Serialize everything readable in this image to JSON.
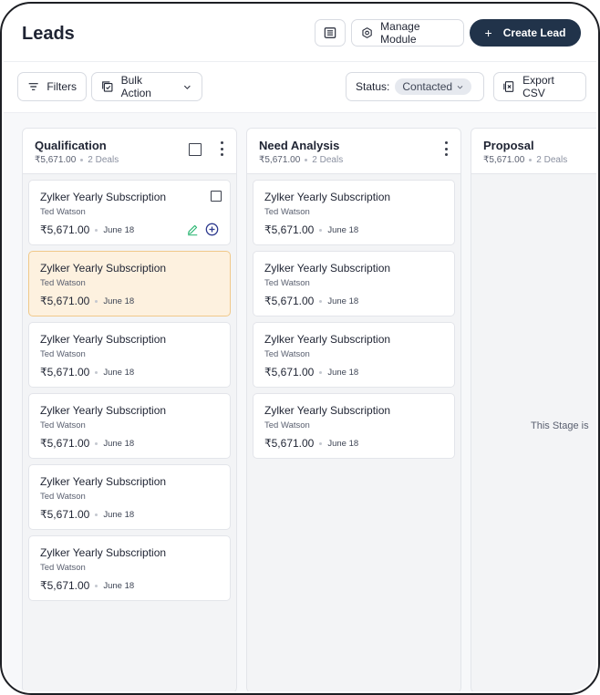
{
  "header": {
    "title": "Leads",
    "manage_label": "Manage Module",
    "create_label": "Create Lead",
    "create_prefix": "+"
  },
  "toolbar": {
    "filters_label": "Filters",
    "bulk_label": "Bulk Action",
    "status_label": "Status:",
    "status_value": "Contacted",
    "export_label": "Export CSV"
  },
  "columns": [
    {
      "title": "Qualification",
      "amount": "₹5,671.00",
      "deals": "2 Deals",
      "cards": [
        {
          "title": "Zylker Yearly Subscription",
          "owner": "Ted Watson",
          "amount": "₹5,671.00",
          "date": "June 18"
        },
        {
          "title": "Zylker Yearly Subscription",
          "owner": "Ted Watson",
          "amount": "₹5,671.00",
          "date": "June 18"
        },
        {
          "title": "Zylker Yearly Subscription",
          "owner": "Ted Watson",
          "amount": "₹5,671.00",
          "date": "June 18"
        },
        {
          "title": "Zylker Yearly Subscription",
          "owner": "Ted Watson",
          "amount": "₹5,671.00",
          "date": "June 18"
        },
        {
          "title": "Zylker Yearly Subscription",
          "owner": "Ted Watson",
          "amount": "₹5,671.00",
          "date": "June 18"
        },
        {
          "title": "Zylker Yearly Subscription",
          "owner": "Ted Watson",
          "amount": "₹5,671.00",
          "date": "June 18"
        }
      ]
    },
    {
      "title": "Need Analysis",
      "amount": "₹5,671.00",
      "deals": "2 Deals",
      "cards": [
        {
          "title": "Zylker Yearly Subscription",
          "owner": "Ted Watson",
          "amount": "₹5,671.00",
          "date": "June 18"
        },
        {
          "title": "Zylker Yearly Subscription",
          "owner": "Ted Watson",
          "amount": "₹5,671.00",
          "date": "June 18"
        },
        {
          "title": "Zylker Yearly Subscription",
          "owner": "Ted Watson",
          "amount": "₹5,671.00",
          "date": "June 18"
        },
        {
          "title": "Zylker Yearly Subscription",
          "owner": "Ted Watson",
          "amount": "₹5,671.00",
          "date": "June 18"
        }
      ]
    },
    {
      "title": "Proposal",
      "amount": "₹5,671.00",
      "deals": "2 Deals",
      "empty_text": "This Stage is"
    }
  ],
  "colors": {
    "primary": "#21334a",
    "selected_card_bg": "#fdf1df",
    "selected_card_border": "#f0c98a",
    "edit_icon": "#2bb673",
    "plus_icon": "#2f3b8f"
  }
}
